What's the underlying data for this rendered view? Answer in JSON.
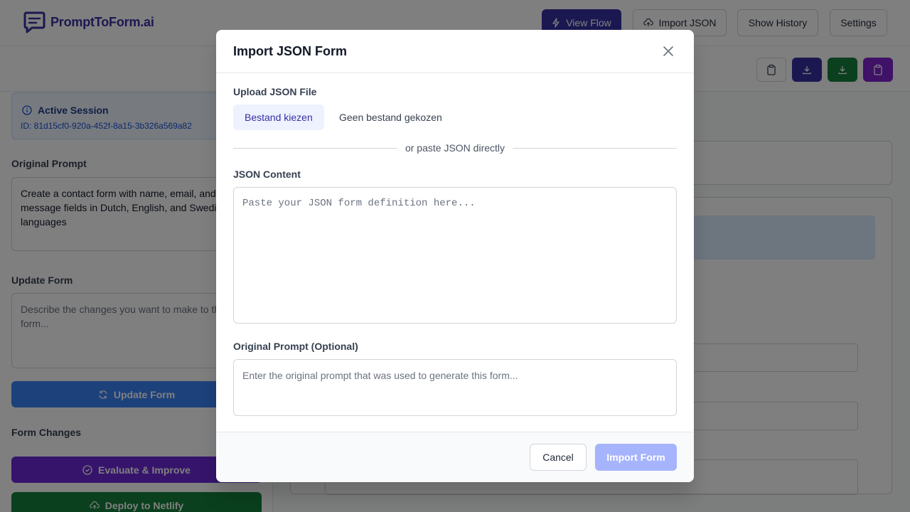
{
  "app": {
    "brand": "PromptToForm.ai",
    "brand_color": "#3730a3"
  },
  "header": {
    "view_flow_label": "View Flow",
    "import_json_label": "Import JSON",
    "show_history_label": "Show History",
    "settings_label": "Settings"
  },
  "toolbar": {
    "icons": [
      "clipboard-icon",
      "download-icon",
      "download-icon",
      "clipboard-icon"
    ]
  },
  "sidebar": {
    "session_title": "Active Session",
    "session_id": "ID: 81d15cf0-920a-452f-8a15-3b326a569a82",
    "original_prompt_label": "Original Prompt",
    "original_prompt_text": "Create a contact form with name, email, and message fields in Dutch, English, and Swedish languages",
    "update_form_label": "Update Form",
    "update_form_placeholder": "Describe the changes you want to make to the form...",
    "update_button_label": "Update Form",
    "form_changes_label": "Form Changes",
    "evaluate_button_label": "Evaluate & Improve",
    "deploy_button_label": "Deploy to Netlify"
  },
  "modal": {
    "title": "Import JSON Form",
    "upload_label": "Upload JSON File",
    "file_button_label": "Bestand kiezen",
    "file_status": "Geen bestand gekozen",
    "divider_text": "or paste JSON directly",
    "json_label": "JSON Content",
    "json_placeholder": "Paste your JSON form definition here...",
    "prompt_label": "Original Prompt (Optional)",
    "prompt_placeholder": "Enter the original prompt that was used to generate this form...",
    "cancel_label": "Cancel",
    "import_label": "Import Form"
  }
}
